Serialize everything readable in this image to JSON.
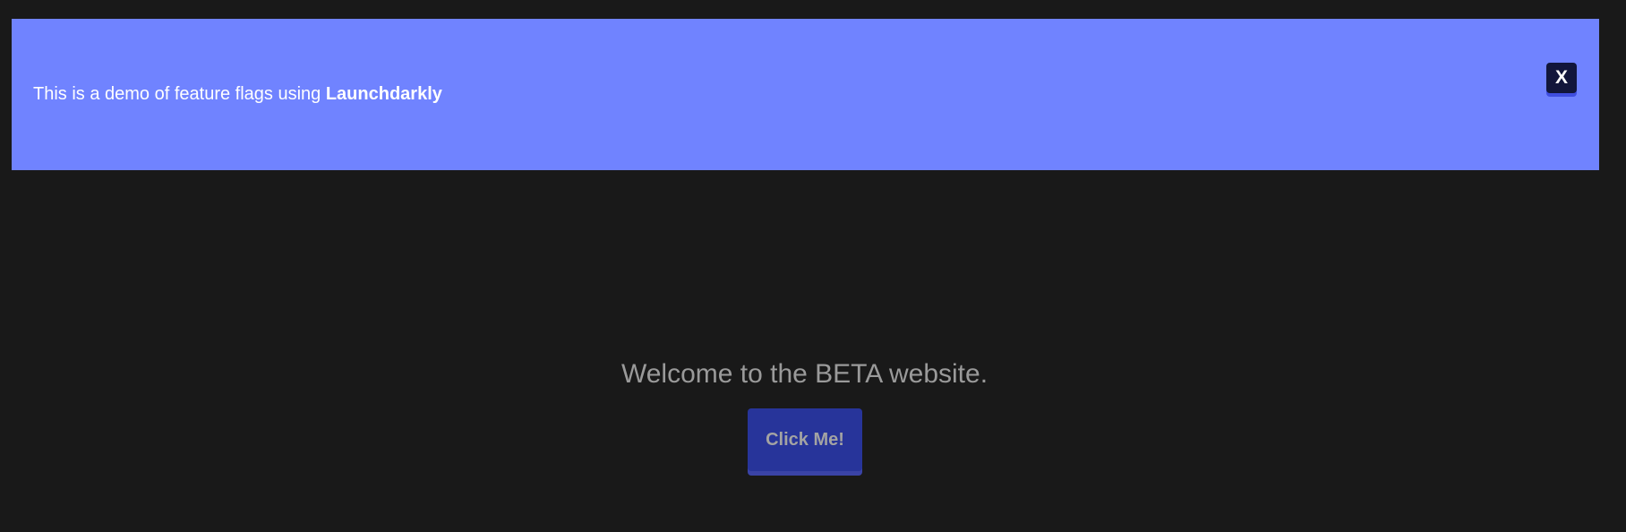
{
  "banner": {
    "text_prefix": "This is a demo of feature flags using ",
    "text_brand": "Launchdarkly",
    "close_label": "X",
    "background_color": "#7083ff"
  },
  "main": {
    "welcome_text": "Welcome to the BETA website.",
    "button_label": "Click Me!",
    "button_color": "#27349a"
  },
  "page": {
    "background_color": "#191919"
  }
}
